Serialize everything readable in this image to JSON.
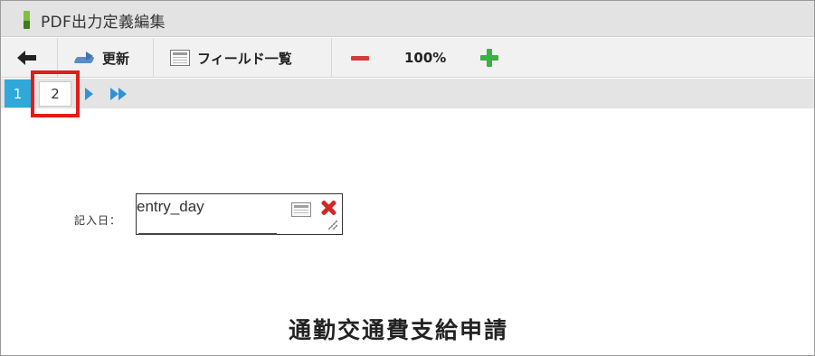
{
  "window": {
    "title": "PDF出力定義編集"
  },
  "toolbar": {
    "refresh_label": "更新",
    "fields_label": "フィールド一覧",
    "zoom_level": "100%"
  },
  "pager": {
    "pages": [
      "1",
      "2"
    ],
    "current_page": "1",
    "highlighted_page": "2"
  },
  "canvas": {
    "field_label": "記入日：",
    "field_value": "entry_day",
    "document_title": "通勤交通費支給申請"
  },
  "colors": {
    "active_page": "#2fa9d9",
    "highlight": "#e41b1b",
    "delete": "#d32626",
    "zoom_in": "#3cb043",
    "zoom_out": "#d83a3a"
  }
}
